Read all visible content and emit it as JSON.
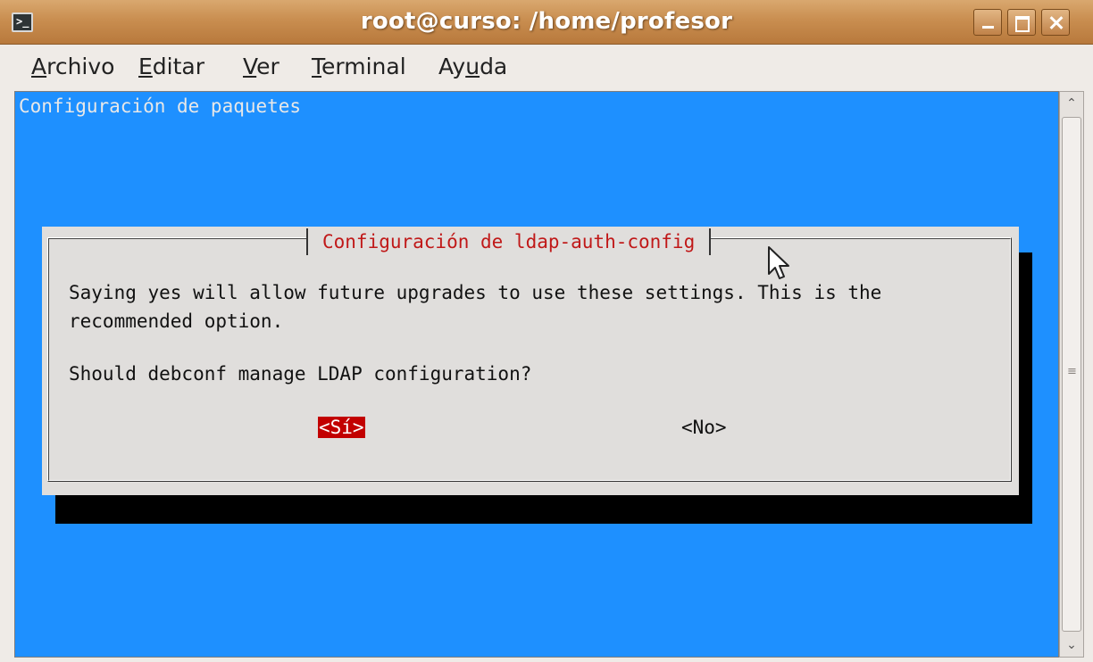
{
  "window": {
    "title": "root@curso: /home/profesor",
    "icon": "terminal-icon",
    "controls": [
      "minimize-icon",
      "maximize-icon",
      "close-icon"
    ]
  },
  "menu": {
    "items": [
      {
        "label": "Archivo",
        "mnemonic": "A"
      },
      {
        "label": "Editar",
        "mnemonic": "E"
      },
      {
        "label": "Ver",
        "mnemonic": "V"
      },
      {
        "label": "Terminal",
        "mnemonic": "T"
      },
      {
        "label": "Ayuda",
        "mnemonic": "u"
      }
    ]
  },
  "terminal": {
    "header": "Configuración de paquetes",
    "background_color": "#1e90ff",
    "dialog": {
      "title": "Configuración de ldap-auth-config",
      "message_line1": "Saying yes will allow future upgrades to use these settings. This is the",
      "message_line2": "recommended option.",
      "question": "Should debconf manage LDAP configuration?",
      "buttons": {
        "yes": "<Sí>",
        "no": "<No>"
      },
      "selected": "yes",
      "selected_color": "#c20000",
      "title_color": "#c01818"
    }
  },
  "scrollbar": {
    "icons": [
      "chevron-up-icon",
      "grip-icon",
      "chevron-down-icon"
    ]
  }
}
